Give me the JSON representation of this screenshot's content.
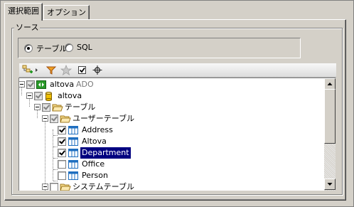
{
  "tabs": [
    {
      "label": "選択範囲"
    },
    {
      "label": "オプション"
    }
  ],
  "source_group": {
    "legend": "ソース",
    "options": [
      {
        "label": "テーブル",
        "selected": true
      },
      {
        "label": "SQL",
        "selected": false
      }
    ]
  },
  "toolbar": {
    "icons": [
      "add-table-icon",
      "filter-icon",
      "favorite-star-icon",
      "checked-only-icon",
      "locate-icon"
    ]
  },
  "tree": {
    "rows": [
      {
        "label": "altova",
        "suffix": "ADO",
        "checked": true
      },
      {
        "label": "altova",
        "checked": true
      },
      {
        "label": "テーブル",
        "checked": true
      },
      {
        "label": "ユーザーテーブル",
        "checked": true
      },
      {
        "label": "Address",
        "checked": true
      },
      {
        "label": "Altova",
        "checked": true
      },
      {
        "label": "Department",
        "checked": true,
        "selected": true
      },
      {
        "label": "Office",
        "checked": false
      },
      {
        "label": "Person",
        "checked": false
      },
      {
        "label": "システムテーブル",
        "checked": false
      }
    ]
  },
  "colors": {
    "selection": "#000080",
    "folder": "#f5d98a",
    "db": "#f0c000",
    "ado": "#2a9a2a",
    "table_icon": "#1f6fc0"
  }
}
